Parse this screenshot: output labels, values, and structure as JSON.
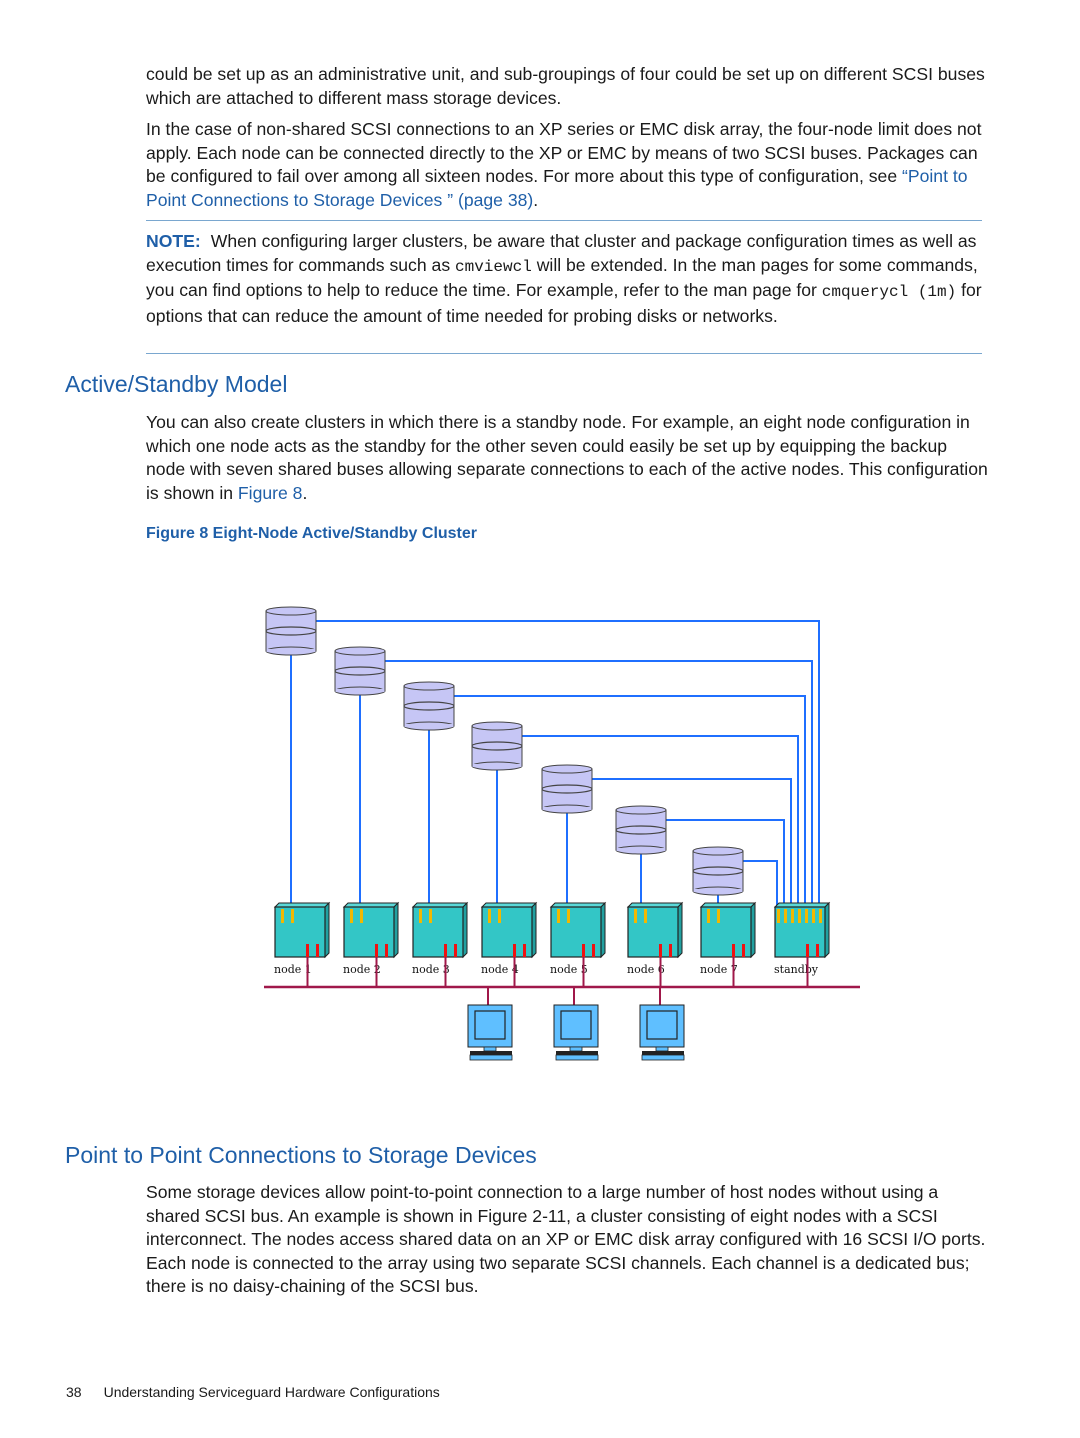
{
  "page": {
    "intro": {
      "p1": "could be set up as an administrative unit, and sub-groupings of four could be set up on different SCSI buses which are attached to different mass storage devices.",
      "p2_before": "In the case of non-shared SCSI connections to an XP series or EMC disk array, the four-node limit does not apply. Each node can be connected directly to the XP or EMC by means of two SCSI buses. Packages can be configured to fail over among all sixteen nodes. For more about this type of configuration, see ",
      "p2_link": "“Point to Point Connections to Storage Devices ” (page 38)",
      "p2_after": "."
    },
    "note": {
      "label": "NOTE:",
      "t1": "When configuring larger clusters, be aware that cluster and package configuration times as well as execution times for commands such as ",
      "cmd1": "cmviewcl",
      "t2": " will be extended. In the man pages for some commands, you can find options to help to reduce the time. For example, refer to the man page for ",
      "cmd2": "cmquerycl (1m)",
      "t3": " for options that can reduce the amount of time needed for probing disks or networks."
    },
    "section1": {
      "heading": "Active/Standby Model",
      "body_before": "You can also create clusters in which there is a standby node. For example, an eight node configuration in which one node acts as the standby for the other seven could easily be set up by equipping the backup node with seven shared buses allowing separate connections to each of the active nodes. This configuration is shown in ",
      "body_link": "Figure 8",
      "body_after": ".",
      "figure_caption": "Figure 8 Eight-Node Active/Standby Cluster"
    },
    "figure": {
      "nodes": [
        "node 1",
        "node 2",
        "node 3",
        "node 4",
        "node 5",
        "node 6",
        "node 7",
        "standby"
      ],
      "disk_count": 7,
      "workstation_count": 3,
      "colors": {
        "disk_fill": "#c6c6f5",
        "scsi_bus": "#1f6fff",
        "node_fill": "#33c6c6",
        "lan": "#a0184a",
        "workstation": "#5fbfff",
        "port_yellow": "#f2b800",
        "port_red": "#ee1111"
      }
    },
    "section2": {
      "heading": "Point to Point Connections to Storage Devices",
      "body": "Some storage devices allow point-to-point connection to a large number of host nodes without using a shared SCSI bus. An example is shown in Figure 2-11, a cluster consisting of eight nodes with a SCSI interconnect. The nodes access shared data on an XP or EMC disk array configured with 16 SCSI I/O ports. Each node is connected to the array using two separate SCSI channels. Each channel is a dedicated bus; there is no daisy-chaining of the SCSI bus."
    },
    "footer": {
      "page_number": "38",
      "chapter": "Understanding Serviceguard Hardware Configurations"
    }
  }
}
